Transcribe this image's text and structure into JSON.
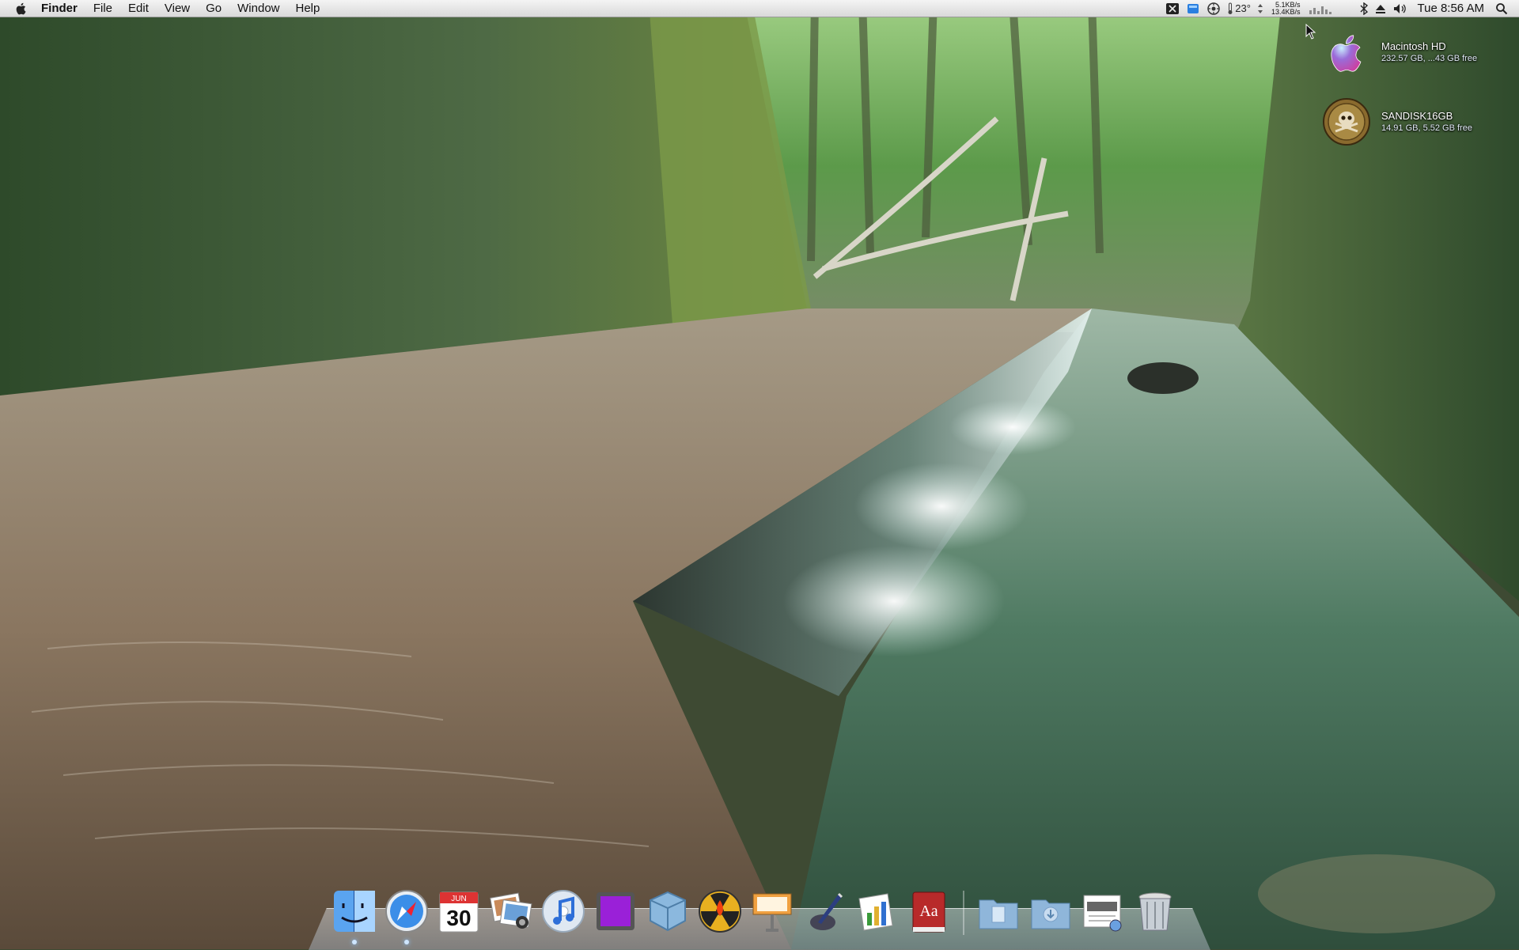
{
  "menubar": {
    "app_name": "Finder",
    "menus": [
      "File",
      "Edit",
      "View",
      "Go",
      "Window",
      "Help"
    ],
    "temperature": "23°",
    "net_up": "5.1KB/s",
    "net_down": "13.4KB/s",
    "clock": "Tue 8:56 AM",
    "icons": [
      "apple-menu-icon",
      "menu-extra-app-icon",
      "menu-extra-window-icon",
      "menu-extra-sensor-icon",
      "network-monitor-icon",
      "bluetooth-icon",
      "eject-icon",
      "volume-icon",
      "spotlight-icon"
    ]
  },
  "desktop": {
    "volumes": [
      {
        "name": "Macintosh HD",
        "info": "232.57 GB, ...43 GB free",
        "icon": "hard-drive-apple-icon"
      },
      {
        "name": "SANDISK16GB",
        "info": "14.91 GB, 5.52 GB free",
        "icon": "usb-drive-skull-icon"
      }
    ]
  },
  "dock": {
    "apps": [
      {
        "name": "Finder",
        "icon": "finder-icon",
        "running": true
      },
      {
        "name": "Safari",
        "icon": "safari-icon",
        "running": true
      },
      {
        "name": "iCal",
        "icon": "calendar-icon",
        "running": false,
        "month": "JUN",
        "day": "30"
      },
      {
        "name": "iPhoto",
        "icon": "iphoto-icon",
        "running": false
      },
      {
        "name": "iTunes",
        "icon": "itunes-icon",
        "running": false
      },
      {
        "name": "Front Row",
        "icon": "purple-square-icon",
        "running": false
      },
      {
        "name": "VirtualBox",
        "icon": "virtualbox-cube-icon",
        "running": false
      },
      {
        "name": "Burn",
        "icon": "burn-radiation-icon",
        "running": false
      },
      {
        "name": "Keynote",
        "icon": "keynote-podium-icon",
        "running": false
      },
      {
        "name": "Mail",
        "icon": "pen-nib-icon",
        "running": false
      },
      {
        "name": "Numbers",
        "icon": "chart-icon",
        "running": false
      },
      {
        "name": "Dictionary",
        "icon": "dictionary-icon",
        "running": false,
        "label": "Aa"
      }
    ],
    "stacks": [
      {
        "name": "Documents",
        "icon": "documents-folder-icon"
      },
      {
        "name": "Downloads",
        "icon": "downloads-folder-icon"
      },
      {
        "name": "Preview",
        "icon": "preview-window-icon"
      },
      {
        "name": "Trash",
        "icon": "trash-icon"
      }
    ]
  }
}
